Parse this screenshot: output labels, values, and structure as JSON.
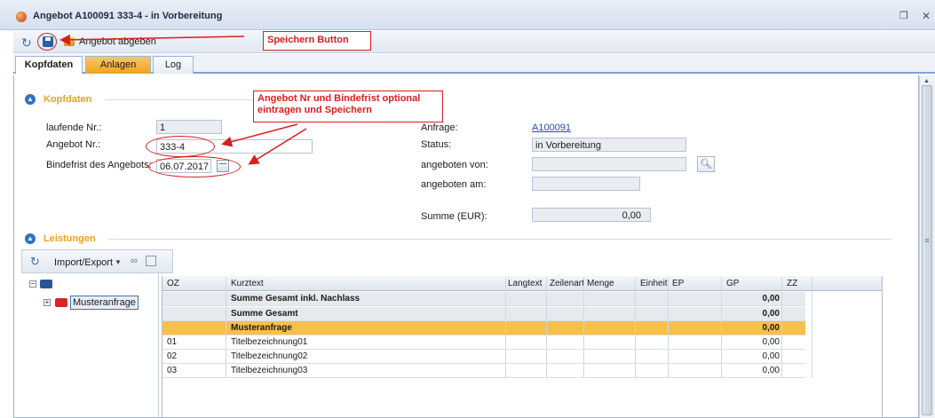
{
  "window": {
    "title": "Angebot A100091 333-4 - in Vorbereitung"
  },
  "toolbar": {
    "submit_label": "Angebot abgeben"
  },
  "tabs": [
    {
      "label": "Kopfdaten",
      "active": true
    },
    {
      "label": "Anlagen",
      "active": false
    },
    {
      "label": "Log",
      "active": false
    }
  ],
  "annotations": {
    "save_callout": "Speichern Button",
    "fields_callout_line1": "Angebot Nr und Bindefrist optional",
    "fields_callout_line2": "eintragen und Speichern"
  },
  "kopfdaten": {
    "section_title": "Kopfdaten",
    "laufende_nr": {
      "label": "laufende Nr.:",
      "value": "1"
    },
    "angebot_nr": {
      "label": "Angebot Nr.:",
      "value": "333-4"
    },
    "bindefrist": {
      "label": "Bindefrist des Angebots:",
      "value": "06.07.2017"
    },
    "anfrage": {
      "label": "Anfrage:",
      "value": "A100091"
    },
    "status": {
      "label": "Status:",
      "value": "in Vorbereitung"
    },
    "angeboten_von": {
      "label": "angeboten von:",
      "value": ""
    },
    "angeboten_am": {
      "label": "angeboten am:",
      "value": ""
    },
    "summe": {
      "label": "Summe (EUR):",
      "value": "0,00"
    }
  },
  "leistungen": {
    "section_title": "Leistungen",
    "import_export_label": "Import/Export",
    "tree": {
      "root_item": "Musteranfrage"
    },
    "grid": {
      "columns": [
        "OZ",
        "Kurztext",
        "Langtext",
        "Zeilenart",
        "Menge",
        "Einheit",
        "EP",
        "GP",
        "ZZ"
      ],
      "rows": [
        {
          "oz": "",
          "kurztext": "Summe Gesamt inkl. Nachlass",
          "gp": "0,00",
          "style": "sum"
        },
        {
          "oz": "",
          "kurztext": "Summe Gesamt",
          "gp": "0,00",
          "style": "sum"
        },
        {
          "oz": "",
          "kurztext": "Musteranfrage",
          "gp": "0,00",
          "style": "highlight"
        },
        {
          "oz": "01",
          "kurztext": "Titelbezeichnung01",
          "gp": "0,00",
          "style": "normal"
        },
        {
          "oz": "02",
          "kurztext": "Titelbezeichnung02",
          "gp": "0,00",
          "style": "normal"
        },
        {
          "oz": "03",
          "kurztext": "Titelbezeichnung03",
          "gp": "0,00",
          "style": "normal"
        }
      ]
    }
  },
  "colors": {
    "accent": "#f0a020",
    "highlight_row": "#f7c04a",
    "sum_row": "#e6eaef",
    "annotation": "#d81e1e"
  }
}
